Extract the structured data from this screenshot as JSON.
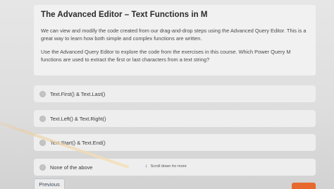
{
  "question": {
    "title": "The Advanced Editor – Text Functions in M",
    "paragraph1": "We can view and modify the code created from our drag-and-drop steps using the Advanced Query Editor. This is a great way to learn how both simple and complex functions are written.",
    "paragraph2": "Use the Advanced Query Editor to explore the code from the exercises in this course. Which Power Query M functions are used to extract the first or last characters from a text string?"
  },
  "options": [
    {
      "label": "Text.First() & Text.Last()"
    },
    {
      "label": "Text.Left() & Text.Right()"
    },
    {
      "label": "Text.Start() & Text.End()"
    },
    {
      "label": "None of the above"
    }
  ],
  "scroll_hint": {
    "icon": "arrow-down-icon",
    "text": "Scroll down for more"
  },
  "nav": {
    "previous_label": "Previous"
  },
  "colors": {
    "accent": "#e8692e",
    "card": "#f1f1f1",
    "background": "#dcdcdc"
  }
}
